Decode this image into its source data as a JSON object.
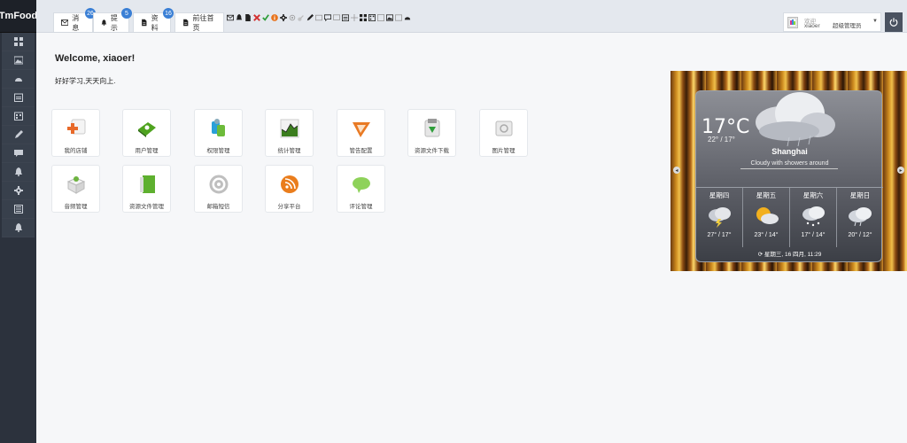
{
  "app": {
    "brand": "TmFood"
  },
  "sidebar": {
    "items": [
      {
        "icon": "dashboard-icon"
      },
      {
        "icon": "picture-icon"
      },
      {
        "icon": "dashboard-gauge-icon"
      },
      {
        "icon": "calendar-icon"
      },
      {
        "icon": "calendar-grid-icon"
      },
      {
        "icon": "pencil-icon"
      },
      {
        "icon": "comment-icon"
      },
      {
        "icon": "bell-icon"
      },
      {
        "icon": "gear-icon"
      },
      {
        "icon": "grid-icon"
      },
      {
        "icon": "bell-alert-icon"
      }
    ]
  },
  "tabs": [
    {
      "label": "消息",
      "badge": "26",
      "icon": "mail-icon"
    },
    {
      "label": "提示",
      "badge": "5",
      "icon": "bell-icon"
    },
    {
      "label": "资料",
      "badge": "16",
      "icon": "document-icon"
    },
    {
      "label": "前往首页",
      "badge": "",
      "icon": "document-icon"
    }
  ],
  "topicons": [
    "mail-icon",
    "bell-icon",
    "document-icon",
    "close-icon",
    "check-icon",
    "info-icon",
    "gear-icon",
    "gear-icon",
    "pencil-icon",
    "comment-icon",
    "calendar-icon",
    "cursor-icon",
    "grid-icon",
    "calendar-icon",
    "picture-icon",
    "image-icon",
    "dashboard-icon"
  ],
  "user": {
    "welcome": "欢迎",
    "name": "xiaoer",
    "role": "超级管理员"
  },
  "main": {
    "title": "Welcome, xiaoer!",
    "subtitle": "好好学习,天天向上.",
    "tiles": [
      {
        "label": "我的店铺",
        "icon": "store-add-icon"
      },
      {
        "label": "用户管理",
        "icon": "user-book-icon"
      },
      {
        "label": "权限管理",
        "icon": "permission-icon"
      },
      {
        "label": "统计管理",
        "icon": "statistics-chart-icon"
      },
      {
        "label": "管告配置",
        "icon": "ad-config-icon"
      },
      {
        "label": "资源文件下载",
        "icon": "download-icon"
      },
      {
        "label": "图片管理",
        "icon": "image-folder-icon"
      },
      {
        "label": "音频管理",
        "icon": "audio-box-icon"
      },
      {
        "label": "资源文件管理",
        "icon": "green-book-icon"
      },
      {
        "label": "邮箱短信",
        "icon": "email-at-icon"
      },
      {
        "label": "分享平台",
        "icon": "rss-share-icon"
      },
      {
        "label": "评论管理",
        "icon": "comment-cloud-icon"
      }
    ]
  },
  "weather": {
    "temp": "17°C",
    "range": "22° / 17°",
    "city": "Shanghai",
    "description": "Cloudy with showers around",
    "forecast": [
      {
        "day": "星期四",
        "temps": "27° / 17°",
        "icon": "thunderstorm-icon"
      },
      {
        "day": "星期五",
        "temps": "23° / 14°",
        "icon": "partly-sunny-icon"
      },
      {
        "day": "星期六",
        "temps": "17° / 14°",
        "icon": "cloud-snow-icon"
      },
      {
        "day": "星期日",
        "temps": "20° / 12°",
        "icon": "cloud-rain-icon"
      }
    ],
    "updated": "星期三, 16 四月, 11:29"
  }
}
